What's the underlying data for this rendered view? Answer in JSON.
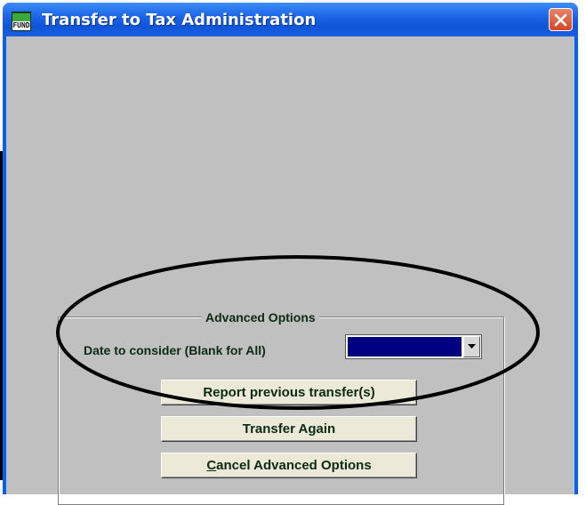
{
  "window": {
    "title": "Transfer to Tax Administration",
    "icon": "fund-app-icon",
    "icon_top_text": "FUND",
    "icon_bottom_text": "FUND"
  },
  "advanced_options": {
    "title": "Advanced Options",
    "date_label": "Date to consider (Blank for All)",
    "date_value": "",
    "buttons": {
      "report": "Report previous transfer(s)",
      "transfer_again": "Transfer Again",
      "cancel_accel": "C",
      "cancel_rest": "ancel Advanced Options"
    }
  },
  "colors": {
    "title_bar": "#0a5ef0",
    "client_bg": "#c0c0c0",
    "selection": "#000080",
    "close_button": "#d4462a",
    "text": "#0a2a12"
  }
}
